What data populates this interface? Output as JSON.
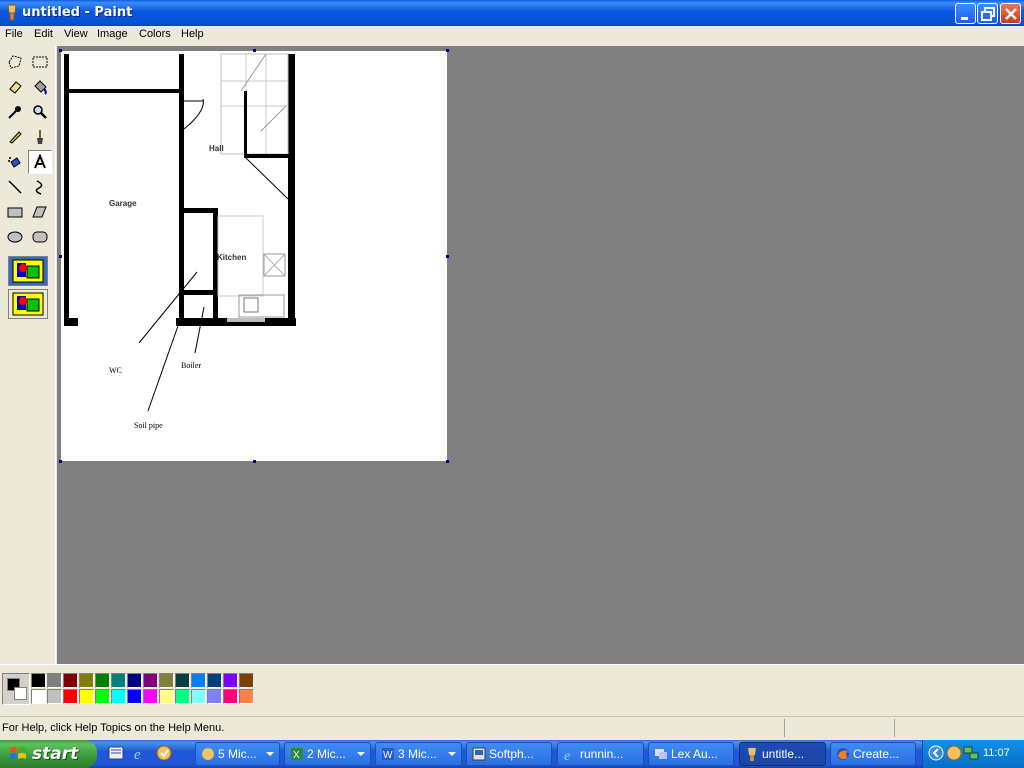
{
  "window": {
    "title": "untitled - Paint"
  },
  "menu": [
    "File",
    "Edit",
    "View",
    "Image",
    "Colors",
    "Help"
  ],
  "canvas": {
    "labels": {
      "garage": "Garage",
      "hall": "Hall",
      "kitchen": "Kitchen",
      "wc": "WC",
      "boiler": "Boiler",
      "soil_pipe": "Soil pipe"
    }
  },
  "palette": {
    "foreground": "#000000",
    "background": "#ffffff",
    "row1": [
      "#000000",
      "#808080",
      "#800000",
      "#808000",
      "#008000",
      "#008080",
      "#000080",
      "#800080",
      "#808040",
      "#004040",
      "#0080ff",
      "#004080",
      "#8000ff",
      "#804000"
    ],
    "row2": [
      "#ffffff",
      "#c0c0c0",
      "#ff0000",
      "#ffff00",
      "#00ff00",
      "#00ffff",
      "#0000ff",
      "#ff00ff",
      "#ffff80",
      "#00ff80",
      "#80ffff",
      "#8080ff",
      "#ff0080",
      "#ff8040"
    ]
  },
  "status": {
    "help_text": "For Help, click Help Topics on the Help Menu."
  },
  "taskbar": {
    "start_label": "start",
    "tasks": [
      "5 Mic...",
      "2 Mic...",
      "3 Mic...",
      "Softph...",
      "runnin...",
      "Lex Au...",
      "untitle...",
      "Create..."
    ],
    "clock": "11:07"
  }
}
